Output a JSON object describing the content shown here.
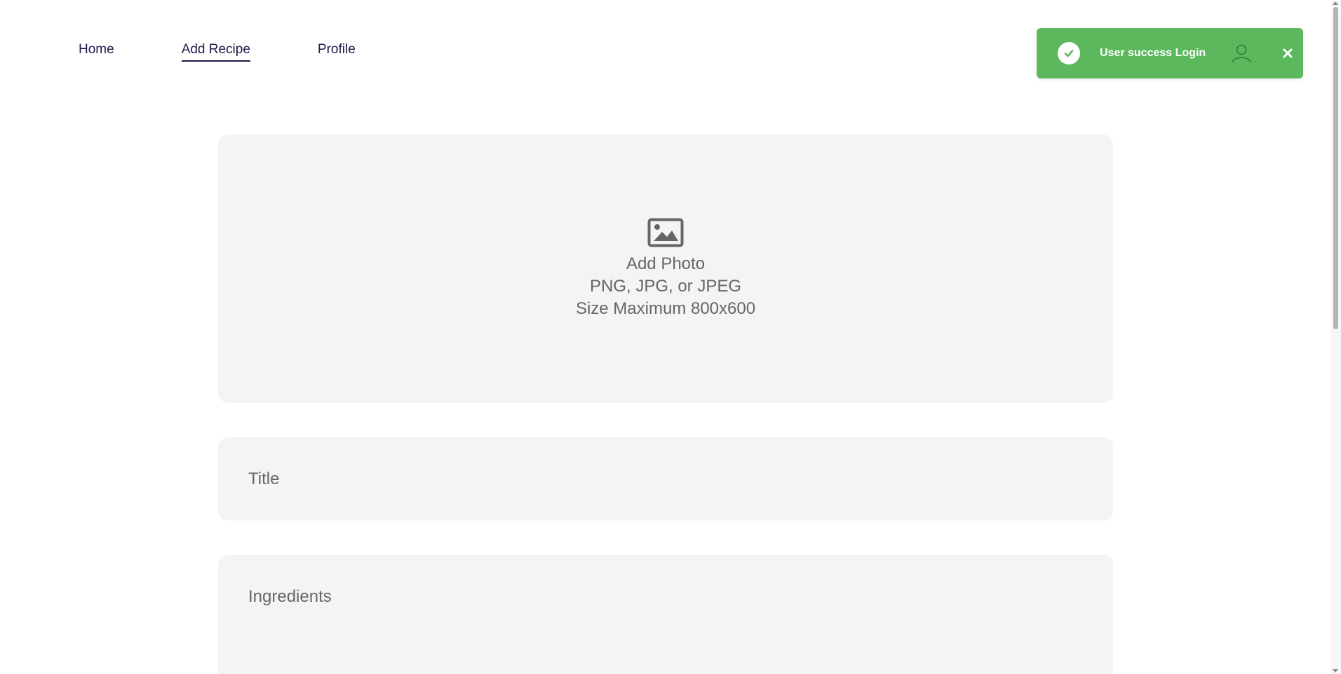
{
  "nav": {
    "items": [
      {
        "label": "Home",
        "active": false
      },
      {
        "label": "Add Recipe",
        "active": true
      },
      {
        "label": "Profile",
        "active": false
      }
    ]
  },
  "toast": {
    "message": "User success Login",
    "color": "#5cb85c",
    "icons": [
      "check-circle-icon",
      "user-icon",
      "close-icon"
    ]
  },
  "photo": {
    "icon": "image-icon",
    "line1": "Add Photo",
    "line2": "PNG, JPG, or JPEG",
    "line3": "Size Maximum 800x600"
  },
  "form": {
    "title_placeholder": "Title",
    "ingredients_placeholder": "Ingredients"
  }
}
